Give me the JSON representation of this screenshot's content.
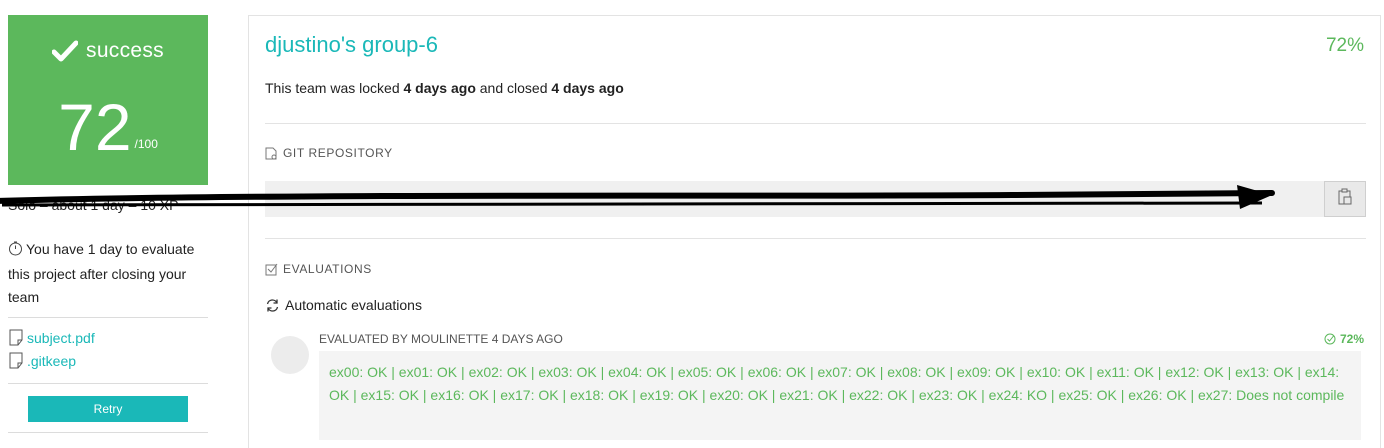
{
  "sidebar": {
    "status_label": "success",
    "score": "72",
    "score_max": "/100",
    "meta": "Solo – about 1 day – 10 XP",
    "eval_notice": "You have 1 day to evaluate this project after closing your team",
    "files": [
      "subject.pdf",
      ".gitkeep"
    ],
    "retry_label": "Retry"
  },
  "team": {
    "title": "djustino's group-6",
    "percent": "72%",
    "lock_prefix": "This team was locked",
    "locked_ago": "4 days ago",
    "lock_middle": "and closed",
    "closed_ago": "4 days ago"
  },
  "repository": {
    "header": "GIT REPOSITORY",
    "url": ""
  },
  "evaluations": {
    "header": "EVALUATIONS",
    "auto_title": "Automatic evaluations",
    "evaluated_by": "EVALUATED BY MOULINETTE 4 DAYS AGO",
    "score": "72%",
    "results": "ex00: OK | ex01: OK | ex02: OK | ex03: OK | ex04: OK | ex05: OK | ex06: OK | ex07: OK | ex08: OK | ex09: OK | ex10: OK | ex11: OK | ex12: OK | ex13: OK | ex14: OK | ex15: OK | ex16: OK | ex17: OK | ex18: OK | ex19: OK | ex20: OK | ex21: OK | ex22: OK | ex23: OK | ex24: KO | ex25: OK | ex26: OK | ex27: Does not compile"
  },
  "colors": {
    "success": "#5cb85c",
    "accent": "#1ab8b8"
  },
  "icons": [
    "check-icon",
    "timer-icon",
    "file-icon",
    "repository-icon",
    "clipboard-icon",
    "checkbox-icon",
    "refresh-icon",
    "check-circle-icon"
  ]
}
